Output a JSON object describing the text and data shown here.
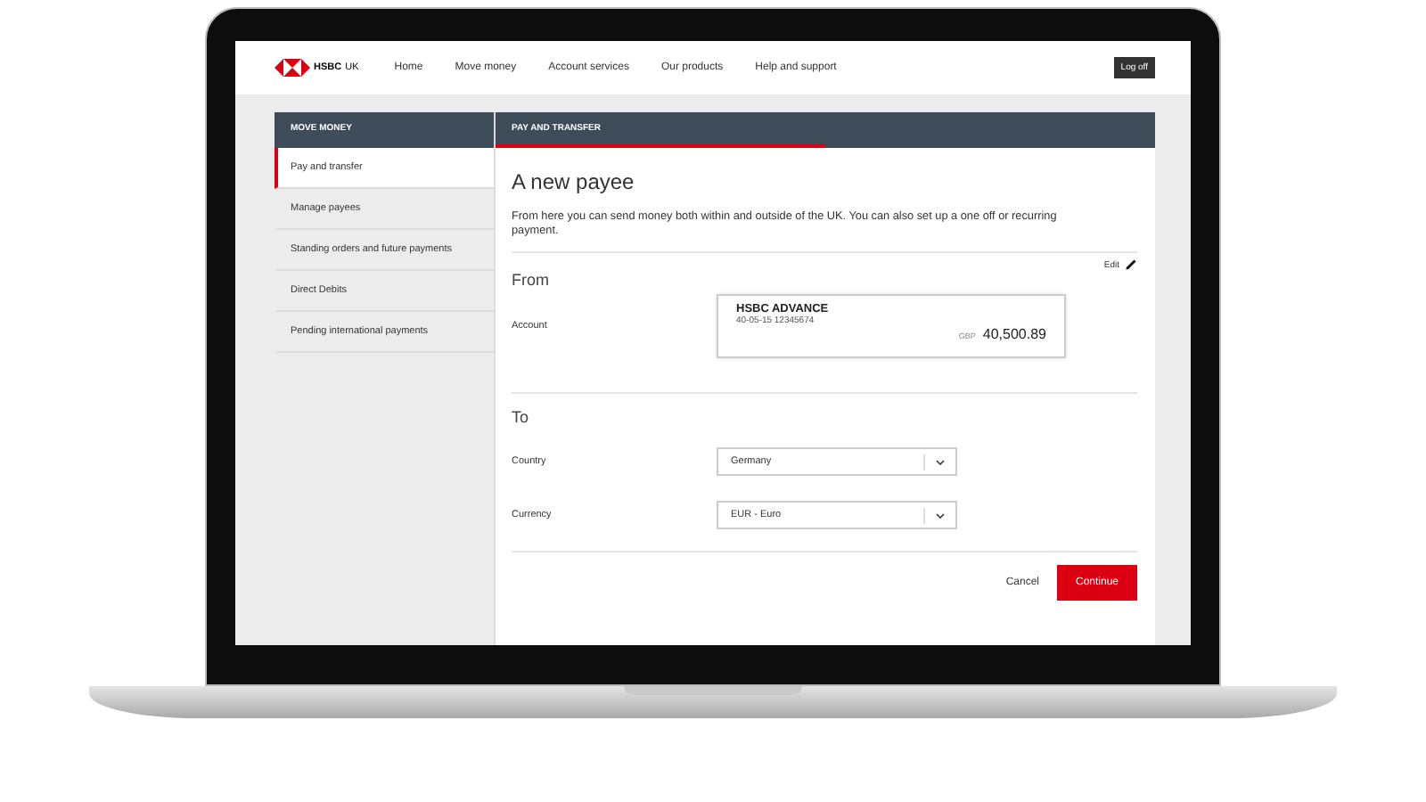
{
  "brand": {
    "name": "HSBC",
    "suffix": "UK"
  },
  "nav": [
    {
      "label": "Home"
    },
    {
      "label": "Move money"
    },
    {
      "label": "Account services"
    },
    {
      "label": "Our products"
    },
    {
      "label": "Help and support"
    }
  ],
  "logoff": "Log off",
  "sidebar": {
    "title": "MOVE MONEY",
    "items": [
      {
        "label": "Pay and transfer",
        "selected": true
      },
      {
        "label": "Manage payees",
        "selected": false
      },
      {
        "label": "Standing orders and future payments",
        "selected": false
      },
      {
        "label": "Direct Debits",
        "selected": false
      },
      {
        "label": "Pending international payments",
        "selected": false
      }
    ]
  },
  "tabs": [
    {
      "label": "PAY AND TRANSFER",
      "selected": true
    }
  ],
  "page": {
    "title": "A new payee",
    "intro": "From here you can send money both within and outside of the UK. You can also set up a one off or recurring payment.",
    "edit": "Edit",
    "from": {
      "heading": "From",
      "label": "Account",
      "account": {
        "name": "HSBC ADVANCE",
        "number": "40-05-15 12345674",
        "currency": "GBP",
        "balance": "40,500.89"
      }
    },
    "to": {
      "heading": "To",
      "fields": [
        {
          "label": "Country",
          "value": "Germany"
        },
        {
          "label": "Currency",
          "value": "EUR - Euro"
        }
      ]
    },
    "actions": {
      "cancel": "Cancel",
      "continue": "Continue"
    }
  }
}
